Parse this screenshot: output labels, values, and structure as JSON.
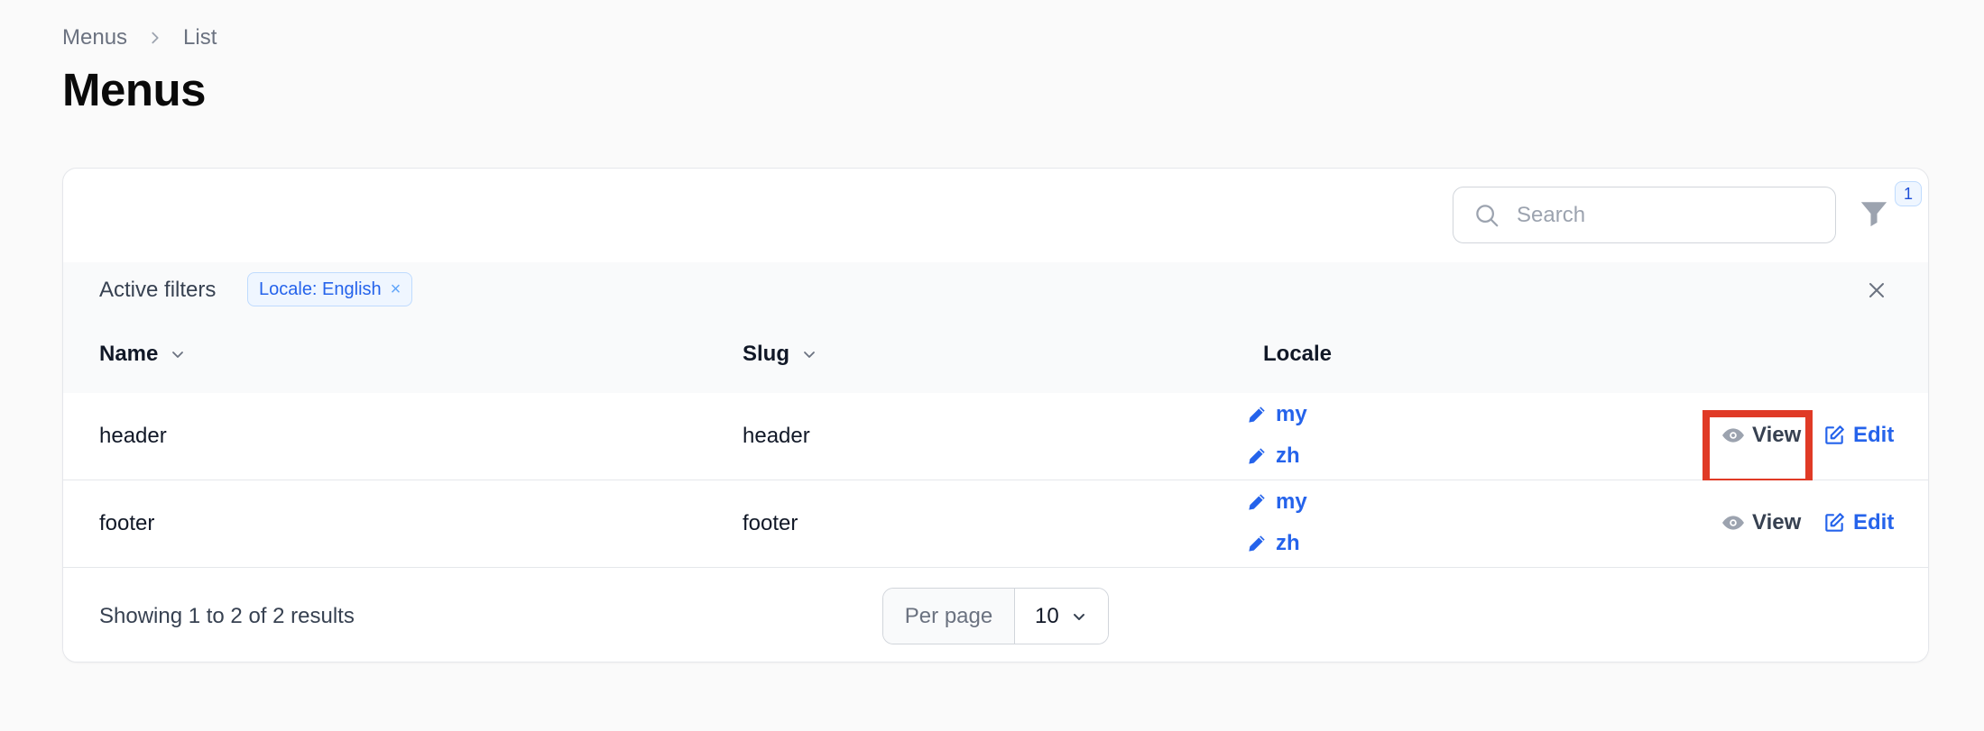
{
  "breadcrumb": {
    "parent": "Menus",
    "current": "List"
  },
  "page_title": "Menus",
  "search": {
    "placeholder": "Search"
  },
  "filter": {
    "count": "1"
  },
  "active_filters": {
    "label": "Active filters",
    "chip": "Locale: English",
    "chip_remove": "×"
  },
  "columns": {
    "name": "Name",
    "slug": "Slug",
    "locale": "Locale"
  },
  "rows": [
    {
      "name": "header",
      "slug": "header",
      "locales": [
        "my",
        "zh"
      ],
      "view": "View",
      "edit": "Edit"
    },
    {
      "name": "footer",
      "slug": "footer",
      "locales": [
        "my",
        "zh"
      ],
      "view": "View",
      "edit": "Edit"
    }
  ],
  "footer": {
    "results": "Showing 1 to 2 of 2 results",
    "per_page_label": "Per page",
    "per_page_value": "10"
  },
  "colors": {
    "primary": "#2563eb",
    "highlight": "#e03a26",
    "background": "#fafafa"
  }
}
